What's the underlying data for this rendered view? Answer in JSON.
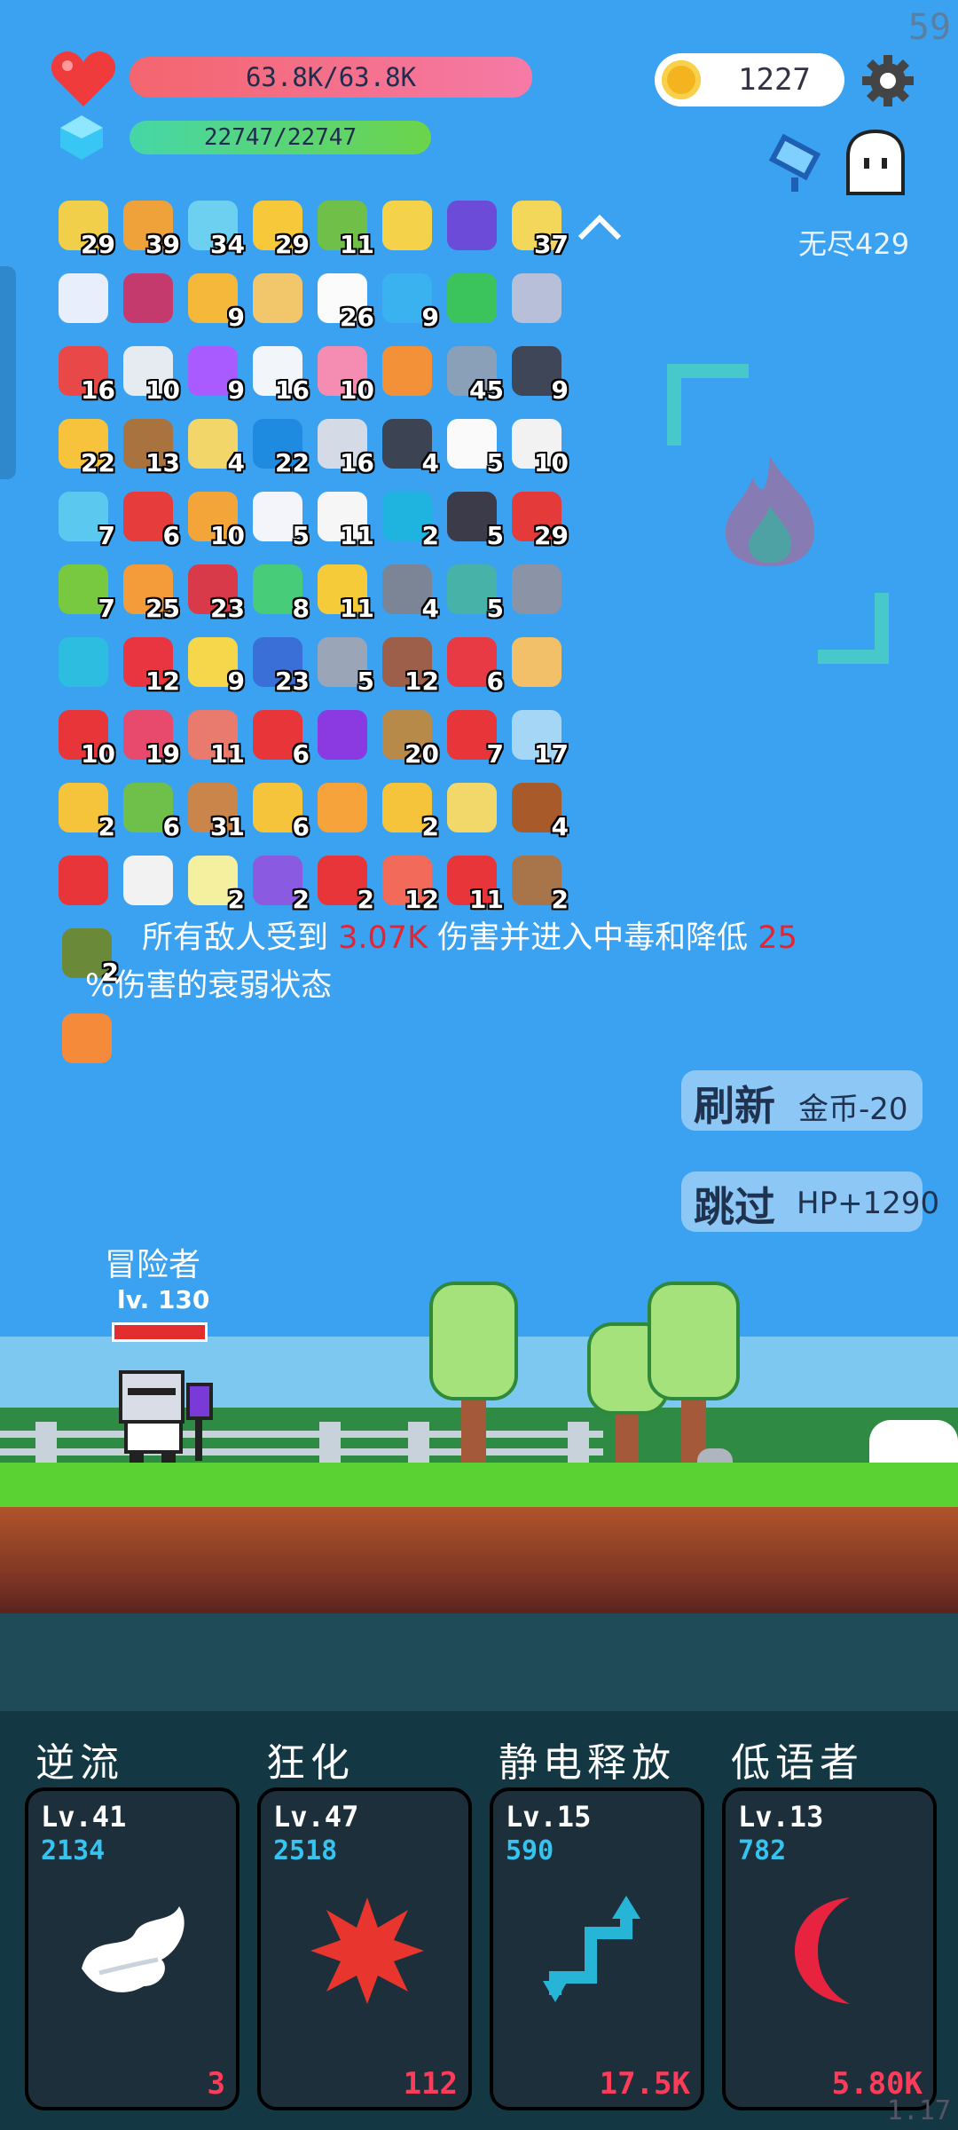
{
  "fps": "59",
  "version": "1.17",
  "hp": "63.8K/63.8K",
  "mp": "22747/22747",
  "coins": "1227",
  "mode": "无尽429",
  "items": [
    {
      "label": "29",
      "color": "#f2cf4a"
    },
    {
      "label": "39",
      "color": "#f0a23a"
    },
    {
      "label": "34",
      "color": "#6ed0f0"
    },
    {
      "label": "29",
      "color": "#f7c93a"
    },
    {
      "label": "11",
      "color": "#6fbf48"
    },
    {
      "label": "",
      "color": "#f4d34a"
    },
    {
      "label": "",
      "color": "#6c4bd8"
    },
    {
      "label": "37",
      "color": "#f3d75b"
    },
    {
      "label": "",
      "color": "#e8eefb"
    },
    {
      "label": "",
      "color": "#c43a6c"
    },
    {
      "label": "9",
      "color": "#f5b83a"
    },
    {
      "label": "",
      "color": "#f2c66a"
    },
    {
      "label": "26",
      "color": "#fbfbfb"
    },
    {
      "label": "9",
      "color": "#3ab2f0"
    },
    {
      "label": "",
      "color": "#3bc35c"
    },
    {
      "label": "",
      "color": "#b7c0d8"
    },
    {
      "label": "16",
      "color": "#e94848"
    },
    {
      "label": "10",
      "color": "#e6ebf2"
    },
    {
      "label": "9",
      "color": "#a95bff"
    },
    {
      "label": "16",
      "color": "#f2f6fb"
    },
    {
      "label": "10",
      "color": "#f58cb2"
    },
    {
      "label": "",
      "color": "#f39139"
    },
    {
      "label": "45",
      "color": "#8aa0b8"
    },
    {
      "label": "9",
      "color": "#3e4658"
    },
    {
      "label": "22",
      "color": "#f7c23c"
    },
    {
      "label": "13",
      "color": "#a8733e"
    },
    {
      "label": "4",
      "color": "#f3d66a"
    },
    {
      "label": "22",
      "color": "#1e8ae0"
    },
    {
      "label": "16",
      "color": "#d4dbe6"
    },
    {
      "label": "4",
      "color": "#3c4454"
    },
    {
      "label": "5",
      "color": "#fafafa"
    },
    {
      "label": "10",
      "color": "#f2f2f2"
    },
    {
      "label": "7",
      "color": "#5bc8f0"
    },
    {
      "label": "6",
      "color": "#e63c3c"
    },
    {
      "label": "10",
      "color": "#f4a53a"
    },
    {
      "label": "5",
      "color": "#f3f5fa"
    },
    {
      "label": "11",
      "color": "#f6f6f6"
    },
    {
      "label": "2",
      "color": "#1fb3e0"
    },
    {
      "label": "5",
      "color": "#3b3b4a"
    },
    {
      "label": "29",
      "color": "#e53a3a"
    },
    {
      "label": "7",
      "color": "#78c93f"
    },
    {
      "label": "25",
      "color": "#f49b3a"
    },
    {
      "label": "23",
      "color": "#d83a4a"
    },
    {
      "label": "8",
      "color": "#47cc7a"
    },
    {
      "label": "11",
      "color": "#f5cb3a"
    },
    {
      "label": "4",
      "color": "#7b8595"
    },
    {
      "label": "5",
      "color": "#47b2a8"
    },
    {
      "label": "",
      "color": "#8a94a6"
    },
    {
      "label": "",
      "color": "#2dbde0"
    },
    {
      "label": "12",
      "color": "#e8353f"
    },
    {
      "label": "9",
      "color": "#f6d64a"
    },
    {
      "label": "23",
      "color": "#3a6fd8"
    },
    {
      "label": "5",
      "color": "#9aa6b8"
    },
    {
      "label": "12",
      "color": "#9d5f4a"
    },
    {
      "label": "6",
      "color": "#e83a44"
    },
    {
      "label": "",
      "color": "#f3c06a"
    },
    {
      "label": "10",
      "color": "#e8353a"
    },
    {
      "label": "19",
      "color": "#e84a6e"
    },
    {
      "label": "11",
      "color": "#e87a6e"
    },
    {
      "label": "6",
      "color": "#e8353a"
    },
    {
      "label": "",
      "color": "#8a3ae0"
    },
    {
      "label": "20",
      "color": "#b88a4a"
    },
    {
      "label": "7",
      "color": "#e8353a"
    },
    {
      "label": "17",
      "color": "#a6d6f5"
    },
    {
      "label": "2",
      "color": "#f5c43a"
    },
    {
      "label": "6",
      "color": "#6fc04a"
    },
    {
      "label": "31",
      "color": "#c9854a"
    },
    {
      "label": "6",
      "color": "#f5c43a"
    },
    {
      "label": "",
      "color": "#f5a33a"
    },
    {
      "label": "2",
      "color": "#f5c43a"
    },
    {
      "label": "",
      "color": "#f2d86a"
    },
    {
      "label": "4",
      "color": "#a85a2a"
    },
    {
      "label": "",
      "color": "#e8353a"
    },
    {
      "label": "",
      "color": "#f2f2f2"
    },
    {
      "label": "2",
      "color": "#f5f0a0"
    },
    {
      "label": "2",
      "color": "#8a5ae0"
    },
    {
      "label": "2",
      "color": "#e8353a"
    },
    {
      "label": "12",
      "color": "#f26a5a"
    },
    {
      "label": "11",
      "color": "#e8353a"
    },
    {
      "label": "2",
      "color": "#a8744a"
    }
  ],
  "extra_items": [
    {
      "label": "2",
      "color": "#6a8a3a"
    },
    {
      "label": "",
      "color": "#f58a3a"
    }
  ],
  "effect": {
    "line1_a": "所有敌人受到 ",
    "line1_dmg": "3.07K",
    "line1_b": " 伤害并进入中毒和降低 ",
    "line1_pct": "25",
    "line2": "%伤害的衰弱状态"
  },
  "actions": {
    "refresh_label": "刷新",
    "refresh_cost": "金币-20",
    "skip_label": "跳过",
    "skip_reward": "HP+1290"
  },
  "hero": {
    "name": "冒险者",
    "level": "lv. 130"
  },
  "skills": [
    {
      "title": "逆流",
      "level": "Lv.41",
      "power": "2134",
      "value": "3"
    },
    {
      "title": "狂化",
      "level": "Lv.47",
      "power": "2518",
      "value": "112"
    },
    {
      "title": "静电释放",
      "level": "Lv.15",
      "power": "590",
      "value": "17.5K"
    },
    {
      "title": "低语者",
      "level": "Lv.13",
      "power": "782",
      "value": "5.80K"
    }
  ]
}
